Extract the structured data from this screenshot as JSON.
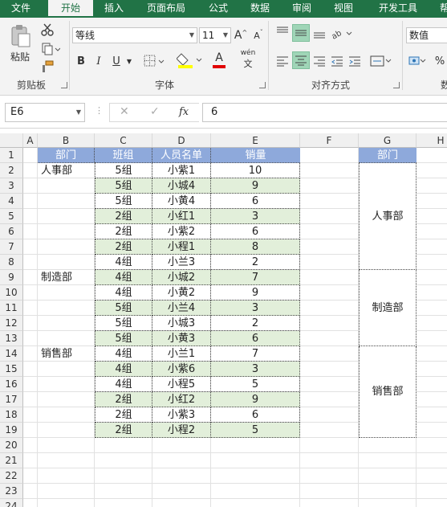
{
  "tabs": [
    "文件",
    "开始",
    "插入",
    "页面布局",
    "公式",
    "数据",
    "审阅",
    "视图",
    "开发工具",
    "帮助"
  ],
  "ribbon": {
    "clipboard": {
      "paste_label": "粘贴",
      "group_label": "剪贴板"
    },
    "font": {
      "name": "等线",
      "size": "11",
      "grow_label": "A",
      "shrink_label": "A",
      "bold": "B",
      "italic": "I",
      "underline": "U",
      "color_a": "A",
      "phonetic_label": "wén",
      "group_label": "字体",
      "font_color": "#e00000",
      "fill_color": "#ffff00"
    },
    "alignment": {
      "group_label": "对齐方式"
    },
    "number": {
      "format": "数值",
      "percent": "%",
      "group_label": "数"
    }
  },
  "formula_bar": {
    "name_box": "E6",
    "cancel": "✕",
    "enter": "✓",
    "fx": "fx",
    "content": "6"
  },
  "columns": [
    "A",
    "B",
    "C",
    "D",
    "E",
    "F",
    "G",
    "H"
  ],
  "rows": [
    "1",
    "2",
    "3",
    "4",
    "5",
    "6",
    "7",
    "8",
    "9",
    "10",
    "11",
    "12",
    "13",
    "14",
    "15",
    "16",
    "17",
    "18",
    "19",
    "20",
    "21",
    "22",
    "23",
    "24"
  ],
  "table": {
    "headers": [
      "部门",
      "班组",
      "人员名单",
      "销量"
    ],
    "departments": [
      "人事部",
      "制造部",
      "销售部"
    ],
    "rows": [
      [
        "5组",
        "小紫1",
        "10"
      ],
      [
        "5组",
        "小城4",
        "9"
      ],
      [
        "5组",
        "小黄4",
        "6"
      ],
      [
        "2组",
        "小红1",
        "3"
      ],
      [
        "2组",
        "小紫2",
        "6"
      ],
      [
        "2组",
        "小程1",
        "8"
      ],
      [
        "4组",
        "小兰3",
        "2"
      ],
      [
        "4组",
        "小城2",
        "7"
      ],
      [
        "4组",
        "小黄2",
        "9"
      ],
      [
        "5组",
        "小兰4",
        "3"
      ],
      [
        "5组",
        "小城3",
        "2"
      ],
      [
        "5组",
        "小黄3",
        "6"
      ],
      [
        "4组",
        "小兰1",
        "7"
      ],
      [
        "4组",
        "小紫6",
        "3"
      ],
      [
        "4组",
        "小程5",
        "5"
      ],
      [
        "2组",
        "小红2",
        "9"
      ],
      [
        "2组",
        "小紫3",
        "6"
      ],
      [
        "2组",
        "小程2",
        "5"
      ]
    ]
  },
  "merged": {
    "header": "部门",
    "items": [
      "人事部",
      "制造部",
      "销售部"
    ]
  },
  "colors": {
    "excel_green": "#217346",
    "header_blue": "#8ea9db",
    "band_green": "#e2efda"
  }
}
